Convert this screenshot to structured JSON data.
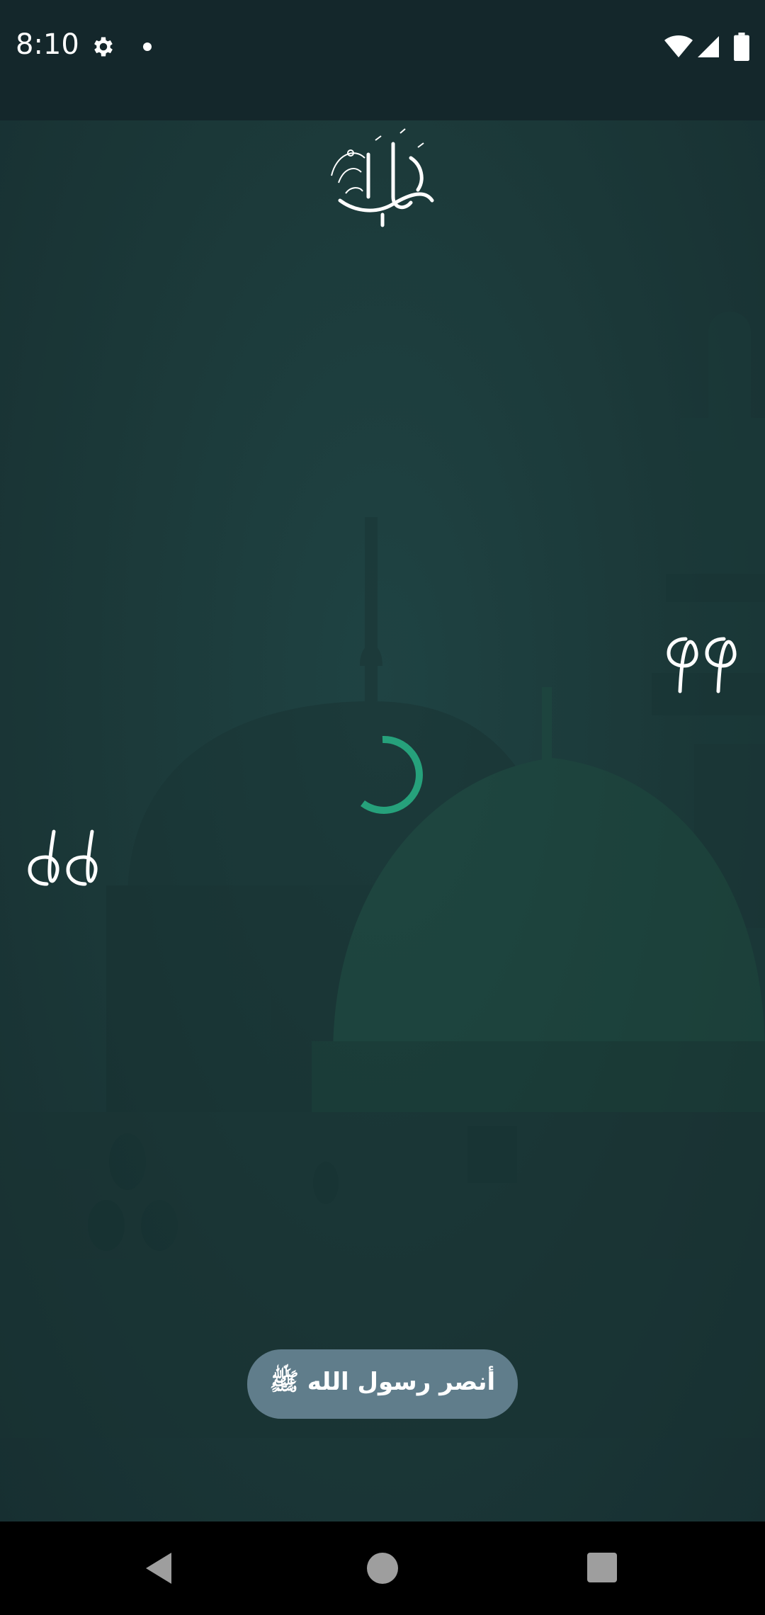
{
  "status_bar": {
    "time": "8:10",
    "icons": [
      "gear-icon",
      "notification-dot-icon",
      "wifi-icon",
      "signal-icon",
      "battery-icon"
    ]
  },
  "splash": {
    "logo": "calligraphy-logo-icon",
    "quote_open": "left-quote-icon",
    "quote_close": "right-quote-icon",
    "loading": "loading-spinner",
    "toast_text": "أنصر رسول الله ﷺ"
  },
  "nav_bar": {
    "icons": [
      "back-icon",
      "home-icon",
      "recents-icon"
    ]
  },
  "colors": {
    "status_bar_bg": "#14272b",
    "content_bg": "#1c3a3a",
    "spinner": "#26a17b",
    "toast_bg": "#607d8b",
    "nav_bg": "#000000"
  }
}
